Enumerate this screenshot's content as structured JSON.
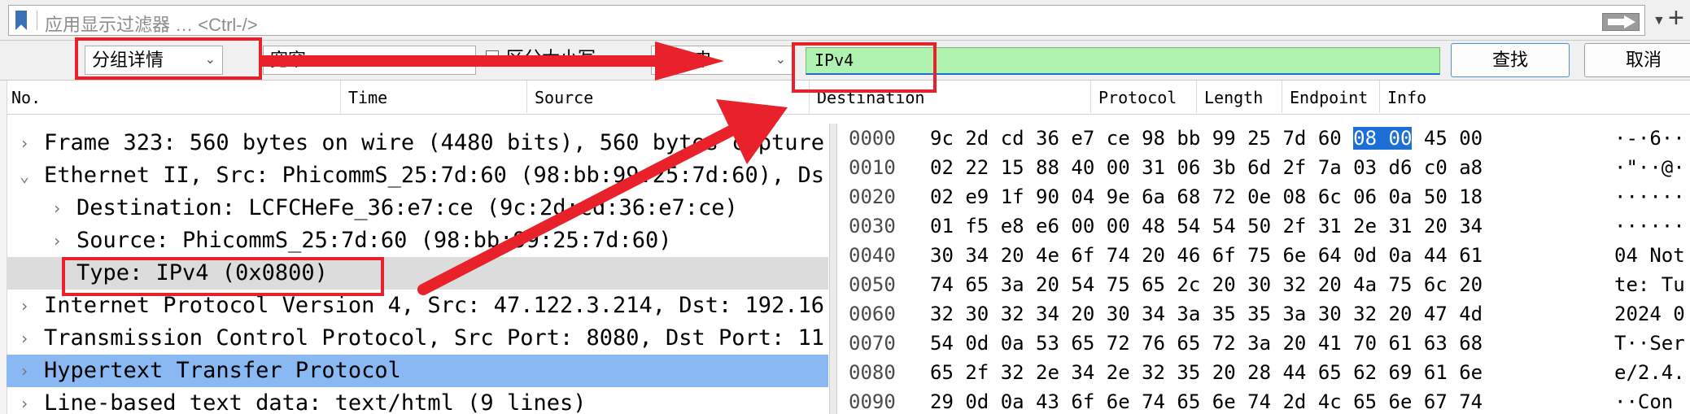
{
  "filter_bar": {
    "placeholder": "应用显示过滤器 … <Ctrl-/>",
    "add_button": "+"
  },
  "find_bar": {
    "display_combo": "分组详情",
    "charset_combo": "宽窄",
    "case_checkbox_label": "区分大小写",
    "type_combo": "字符串",
    "search_value": "IPv4",
    "find_button": "查找",
    "cancel_button": "取消"
  },
  "columns": [
    "No.",
    "Time",
    "Source",
    "Destination",
    "Protocol",
    "Length",
    "Endpoint",
    "Info"
  ],
  "details": [
    {
      "text": "Frame 323: 560 bytes on wire (4480 bits), 560 bytes capture",
      "twisty": "›",
      "state": "normal"
    },
    {
      "text": "Ethernet II, Src: PhicommS_25:7d:60 (98:bb:99:25:7d:60), Ds",
      "twisty": "⌄",
      "state": "normal"
    },
    {
      "text": "Destination: LCFCHeFe_36:e7:ce (9c:2d:cd:36:e7:ce)",
      "twisty": "›",
      "state": "normal"
    },
    {
      "text": "Source: PhicommS_25:7d:60 (98:bb:99:25:7d:60)",
      "twisty": "›",
      "state": "normal"
    },
    {
      "text": "Type: IPv4 (0x0800)",
      "twisty": "",
      "state": "highlighted"
    },
    {
      "text": "Internet Protocol Version 4, Src: 47.122.3.214, Dst: 192.16",
      "twisty": "›",
      "state": "normal"
    },
    {
      "text": "Transmission Control Protocol, Src Port: 8080, Dst Port: 11",
      "twisty": "›",
      "state": "normal"
    },
    {
      "text": "Hypertext Transfer Protocol",
      "twisty": "›",
      "state": "selected"
    },
    {
      "text": "Line-based text data: text/html (9 lines)",
      "twisty": "›",
      "state": "normal"
    }
  ],
  "bytes": [
    {
      "offset": "0000",
      "pre": "9c 2d cd 36 e7 ce 98 bb  99 25 7d 60 ",
      "sel": "08 00",
      "post": " 45 00",
      "ascii": "·-·6··"
    },
    {
      "offset": "0010",
      "pre": "02 22 15 88 40 00 31 06  3b 6d 2f 7a 03 d6 c0 a8",
      "sel": "",
      "post": "",
      "ascii": "·\"··@·"
    },
    {
      "offset": "0020",
      "pre": "02 e9 1f 90 04 9e 6a 68  72 0e 08 6c 06 0a 50 18",
      "sel": "",
      "post": "",
      "ascii": "······"
    },
    {
      "offset": "0030",
      "pre": "01 f5 e8 e6 00 00 48 54  54 50 2f 31 2e 31 20 34",
      "sel": "",
      "post": "",
      "ascii": "······"
    },
    {
      "offset": "0040",
      "pre": "30 34 20 4e 6f 74 20 46  6f 75 6e 64 0d 0a 44 61",
      "sel": "",
      "post": "",
      "ascii": "04 Not"
    },
    {
      "offset": "0050",
      "pre": "74 65 3a 20 54 75 65 2c  20 30 32 20 4a 75 6c 20",
      "sel": "",
      "post": "",
      "ascii": "te: Tu"
    },
    {
      "offset": "0060",
      "pre": "32 30 32 34 20 30 34 3a  35 35 3a 30 32 20 47 4d",
      "sel": "",
      "post": "",
      "ascii": "2024 0"
    },
    {
      "offset": "0070",
      "pre": "54 0d 0a 53 65 72 76 65  72 3a 20 41 70 61 63 68",
      "sel": "",
      "post": "",
      "ascii": "T··Ser"
    },
    {
      "offset": "0080",
      "pre": "65 2f 32 2e 34 2e 32 35  20 28 44 65 62 69 61 6e",
      "sel": "",
      "post": "",
      "ascii": "e/2.4."
    },
    {
      "offset": "0090",
      "pre": "29 0d 0a 43 6f 6e 74 65  6e 74 2d 4c 65 6e 67 74",
      "sel": "",
      "post": "",
      "ascii": "··Con"
    }
  ],
  "colors": {
    "annotation_red": "#e8212a",
    "search_field_bg": "#b0f3b0",
    "selected_row": "#89b8f3",
    "byte_selection": "#1d6fd6"
  },
  "icons": [
    "bookmark-icon",
    "apply-filter-arrow-icon",
    "chevron-down-icon",
    "expand-twisty-icon"
  ]
}
